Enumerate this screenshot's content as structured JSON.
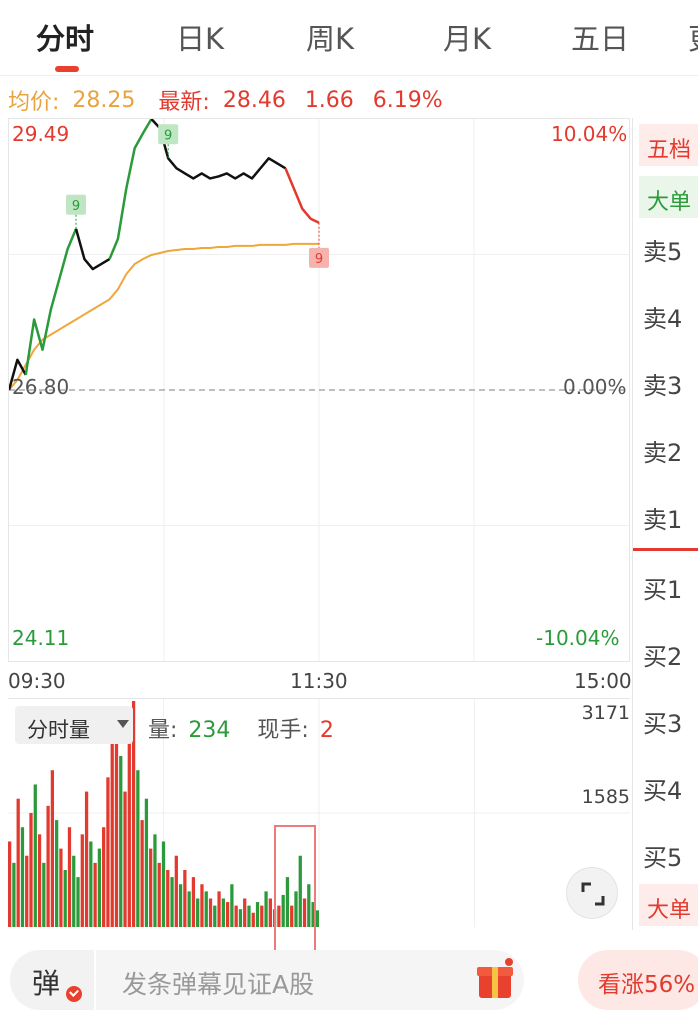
{
  "tabs": [
    {
      "label": "分时",
      "active": true
    },
    {
      "label": "日K",
      "active": false
    },
    {
      "label": "周K",
      "active": false
    },
    {
      "label": "月K",
      "active": false
    },
    {
      "label": "五日",
      "active": false
    },
    {
      "label": "更",
      "active": false
    }
  ],
  "info": {
    "avg_label": "均价:",
    "avg_value": "28.25",
    "latest_label": "最新:",
    "latest_value": "28.46",
    "change": "1.66",
    "change_pct": "6.19%"
  },
  "chart_data": {
    "type": "line",
    "y_high": "29.49",
    "y_base": "26.80",
    "y_low": "24.11",
    "pct_high": "10.04%",
    "pct_base": "0.00%",
    "pct_low": "-10.04%",
    "ylim": [
      24.11,
      29.49
    ],
    "time_labels": [
      "09:30",
      "11:30",
      "15:00"
    ],
    "price": [
      26.8,
      27.1,
      26.95,
      27.5,
      27.2,
      27.6,
      27.9,
      28.2,
      28.4,
      28.1,
      28.0,
      28.05,
      28.1,
      28.3,
      28.8,
      29.2,
      29.35,
      29.49,
      29.4,
      29.1,
      29.0,
      28.95,
      28.9,
      28.95,
      28.9,
      28.92,
      28.95,
      28.9,
      28.95,
      28.9,
      29.0,
      29.1,
      29.05,
      29.0,
      28.8,
      28.6,
      28.5,
      28.46
    ],
    "avg": [
      26.8,
      26.9,
      27.05,
      27.2,
      27.3,
      27.35,
      27.4,
      27.45,
      27.5,
      27.55,
      27.6,
      27.65,
      27.7,
      27.8,
      27.95,
      28.05,
      28.1,
      28.14,
      28.16,
      28.18,
      28.19,
      28.2,
      28.2,
      28.21,
      28.21,
      28.22,
      28.22,
      28.23,
      28.23,
      28.23,
      28.24,
      28.24,
      28.24,
      28.24,
      28.25,
      28.25,
      28.25,
      28.25
    ],
    "markers": [
      {
        "label": "9"
      },
      {
        "label": "9"
      },
      {
        "label": "9"
      },
      {
        "label": "9"
      }
    ]
  },
  "volume": {
    "dropdown_label": "分时量",
    "vol_label": "量:",
    "vol_value": "234",
    "hand_label": "现手:",
    "hand_value": "2",
    "max_label": "3171",
    "mid_label": "1585",
    "ylim": [
      0,
      3171
    ],
    "bars": [
      1200,
      900,
      1800,
      1400,
      1000,
      1600,
      2000,
      1300,
      900,
      1700,
      2200,
      1500,
      1100,
      800,
      1400,
      1000,
      700,
      1300,
      1900,
      1200,
      900,
      1100,
      1400,
      2100,
      2700,
      3000,
      2400,
      1900,
      2800,
      3171,
      2200,
      1500,
      1800,
      1100,
      1300,
      900,
      1200,
      800,
      700,
      1000,
      600,
      800,
      500,
      700,
      400,
      600,
      500,
      400,
      300,
      500,
      400,
      350,
      600,
      300,
      250,
      400,
      300,
      200,
      350,
      300,
      500,
      400,
      250,
      300,
      450,
      700,
      300,
      500,
      1000,
      400,
      600,
      350,
      234
    ],
    "bar_colors": [
      "red",
      "green",
      "red",
      "green",
      "red",
      "red",
      "green",
      "red",
      "green",
      "red",
      "red",
      "green",
      "red",
      "green",
      "red",
      "green",
      "green",
      "red",
      "red",
      "green",
      "red",
      "green",
      "red",
      "red",
      "red",
      "red",
      "green",
      "red",
      "red",
      "red",
      "green",
      "red",
      "green",
      "red",
      "green",
      "red",
      "green",
      "red",
      "green",
      "red",
      "green",
      "red",
      "green",
      "red",
      "green",
      "red",
      "green",
      "red",
      "green",
      "red",
      "green",
      "red",
      "green",
      "red",
      "green",
      "red",
      "green",
      "red",
      "green",
      "red",
      "green",
      "red",
      "green",
      "red",
      "green",
      "green",
      "red",
      "green",
      "green",
      "red",
      "green",
      "green",
      "green"
    ]
  },
  "right_panel": {
    "tab_five": "五档",
    "tab_big": "大单",
    "sell": [
      "卖5",
      "卖4",
      "卖3",
      "卖2",
      "卖1"
    ],
    "buy": [
      "买1",
      "买2",
      "买3",
      "买4",
      "买5"
    ],
    "tab_big_bottom": "大单"
  },
  "bottom": {
    "danmu_label": "弹",
    "placeholder": "发条弹幕见证A股",
    "bull_label": "看涨56%"
  },
  "colors": {
    "up": "#e23a2e",
    "down": "#2b9a3a",
    "avg_line": "#f0a63a",
    "accent": "#e8412d"
  }
}
